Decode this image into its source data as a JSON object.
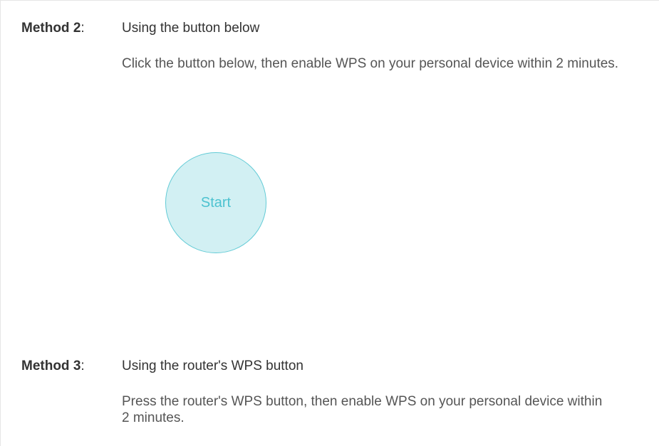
{
  "method2": {
    "label": "Method 2",
    "colon": ":",
    "title": "Using the button below",
    "description": "Click the button below, then enable WPS on your personal device within 2 minutes.",
    "start_button_label": "Start"
  },
  "method3": {
    "label": "Method 3",
    "colon": ":",
    "title": "Using the router's WPS button",
    "description": "Press the router's WPS button, then enable WPS on your personal device within 2 minutes."
  },
  "colors": {
    "start_fill": "#d2f0f3",
    "start_border": "#63cbd6",
    "start_text": "#4cc2d0"
  }
}
